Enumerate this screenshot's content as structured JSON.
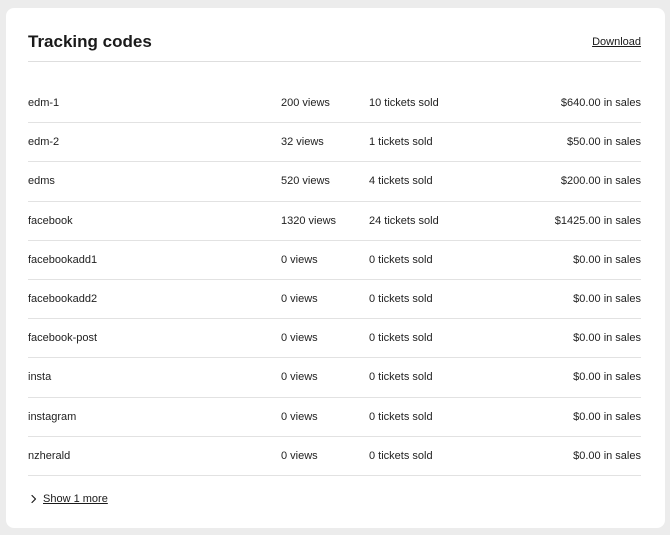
{
  "card": {
    "title": "Tracking codes",
    "download_label": "Download"
  },
  "rows": [
    {
      "code": "edm-1",
      "views": "200 views",
      "tickets": "10 tickets sold",
      "sales": "$640.00 in sales"
    },
    {
      "code": "edm-2",
      "views": "32 views",
      "tickets": "1 tickets sold",
      "sales": "$50.00 in sales"
    },
    {
      "code": "edms",
      "views": "520 views",
      "tickets": "4 tickets sold",
      "sales": "$200.00 in sales"
    },
    {
      "code": "facebook",
      "views": "1320 views",
      "tickets": "24 tickets sold",
      "sales": "$1425.00 in sales"
    },
    {
      "code": "facebookadd1",
      "views": "0 views",
      "tickets": "0 tickets sold",
      "sales": "$0.00 in sales"
    },
    {
      "code": "facebookadd2",
      "views": "0 views",
      "tickets": "0 tickets sold",
      "sales": "$0.00 in sales"
    },
    {
      "code": "facebook-post",
      "views": "0 views",
      "tickets": "0 tickets sold",
      "sales": "$0.00 in sales"
    },
    {
      "code": "insta",
      "views": "0 views",
      "tickets": "0 tickets sold",
      "sales": "$0.00 in sales"
    },
    {
      "code": "instagram",
      "views": "0 views",
      "tickets": "0 tickets sold",
      "sales": "$0.00 in sales"
    },
    {
      "code": "nzherald",
      "views": "0 views",
      "tickets": "0 tickets sold",
      "sales": "$0.00 in sales"
    }
  ],
  "footer": {
    "show_more_label": "Show 1 more",
    "show_more_icon": "chevron-right-icon"
  }
}
